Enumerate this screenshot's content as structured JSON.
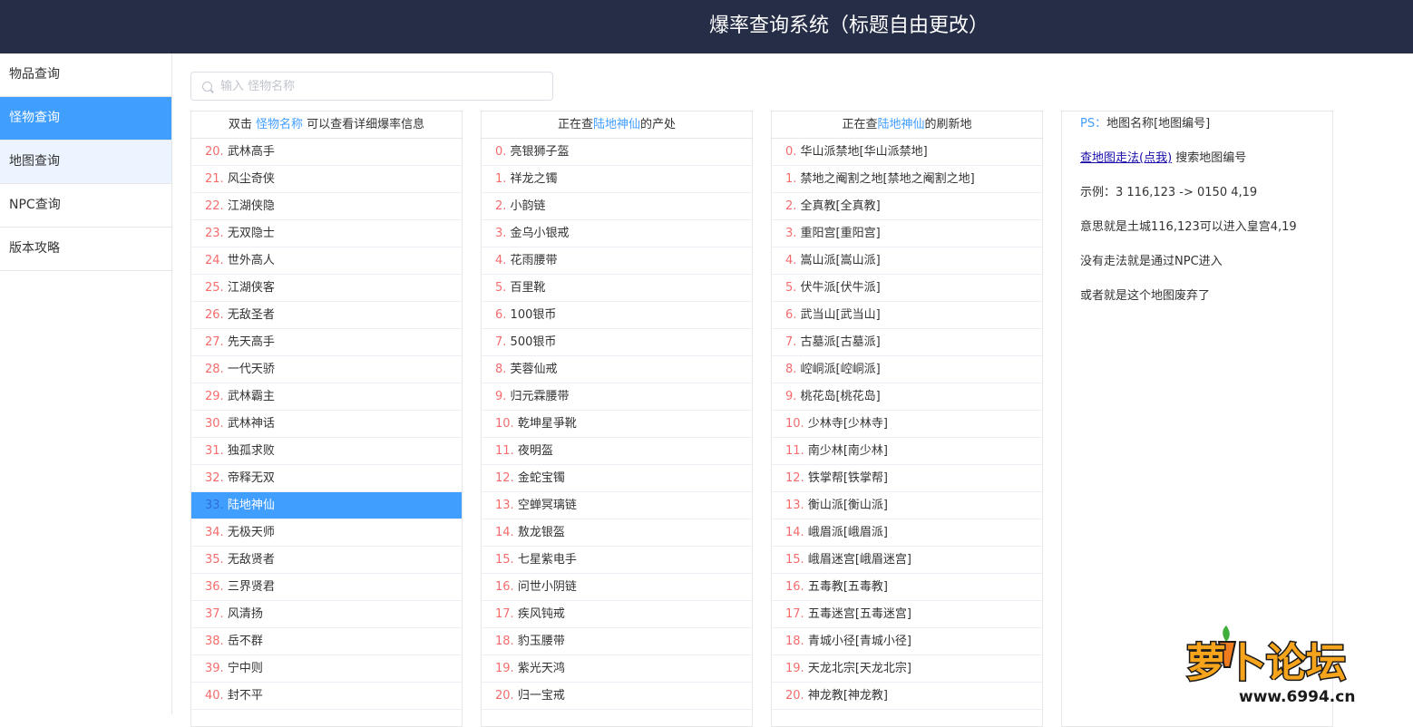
{
  "header": {
    "title": "爆率查询系统（标题自由更改）"
  },
  "sidebar": {
    "items": [
      {
        "label": "物品查询"
      },
      {
        "label": "怪物查询"
      },
      {
        "label": "地图查询"
      },
      {
        "label": "NPC查询"
      },
      {
        "label": "版本攻略"
      }
    ],
    "active_index": 1
  },
  "search": {
    "placeholder": "输入 怪物名称",
    "value": ""
  },
  "monsters": {
    "header_prefix": "双击",
    "header_link": "怪物名称",
    "header_suffix": "可以查看详细爆率信息",
    "selected_index": "33",
    "items": [
      {
        "idx": "20.",
        "name": "武林高手"
      },
      {
        "idx": "21.",
        "name": "风尘奇侠"
      },
      {
        "idx": "22.",
        "name": "江湖侠隐"
      },
      {
        "idx": "23.",
        "name": "无双隐士"
      },
      {
        "idx": "24.",
        "name": "世外高人"
      },
      {
        "idx": "25.",
        "name": "江湖侠客"
      },
      {
        "idx": "26.",
        "name": "无敌圣者"
      },
      {
        "idx": "27.",
        "name": "先天高手"
      },
      {
        "idx": "28.",
        "name": "一代天骄"
      },
      {
        "idx": "29.",
        "name": "武林霸主"
      },
      {
        "idx": "30.",
        "name": "武林神话"
      },
      {
        "idx": "31.",
        "name": "独孤求败"
      },
      {
        "idx": "32.",
        "name": "帝释无双"
      },
      {
        "idx": "33.",
        "name": "陆地神仙"
      },
      {
        "idx": "34.",
        "name": "无极天师"
      },
      {
        "idx": "35.",
        "name": "无敌贤者"
      },
      {
        "idx": "36.",
        "name": "三界贤君"
      },
      {
        "idx": "37.",
        "name": "风清扬"
      },
      {
        "idx": "38.",
        "name": "岳不群"
      },
      {
        "idx": "39.",
        "name": "宁中则"
      },
      {
        "idx": "40.",
        "name": "封不平"
      }
    ]
  },
  "drops": {
    "header_prefix": "正在查",
    "header_monster": "陆地神仙",
    "header_suffix": "的产处",
    "items": [
      {
        "idx": "0.",
        "name": "亮银狮子盔"
      },
      {
        "idx": "1.",
        "name": "祥龙之镯"
      },
      {
        "idx": "2.",
        "name": "小韵链"
      },
      {
        "idx": "3.",
        "name": "金乌小银戒"
      },
      {
        "idx": "4.",
        "name": "花雨腰带"
      },
      {
        "idx": "5.",
        "name": "百里靴"
      },
      {
        "idx": "6.",
        "name": "100银币"
      },
      {
        "idx": "7.",
        "name": "500银币"
      },
      {
        "idx": "8.",
        "name": "芙蓉仙戒"
      },
      {
        "idx": "9.",
        "name": "归元霖腰带"
      },
      {
        "idx": "10.",
        "name": "乾坤星爭靴"
      },
      {
        "idx": "11.",
        "name": "夜明盔"
      },
      {
        "idx": "12.",
        "name": "金蛇宝镯"
      },
      {
        "idx": "13.",
        "name": "空蝉冥璃链"
      },
      {
        "idx": "14.",
        "name": "敖龙银盔"
      },
      {
        "idx": "15.",
        "name": "七星紫电手"
      },
      {
        "idx": "16.",
        "name": "问世小阴链"
      },
      {
        "idx": "17.",
        "name": "疾风钝戒"
      },
      {
        "idx": "18.",
        "name": "豹玉腰带"
      },
      {
        "idx": "19.",
        "name": "紫光天鸿"
      },
      {
        "idx": "20.",
        "name": "归一宝戒"
      }
    ]
  },
  "spawns": {
    "header_prefix": "正在查",
    "header_monster": "陆地神仙",
    "header_suffix": "的刷新地",
    "items": [
      {
        "idx": "0.",
        "name": "华山派禁地[华山派禁地]"
      },
      {
        "idx": "1.",
        "name": "禁地之阉割之地[禁地之阉割之地]"
      },
      {
        "idx": "2.",
        "name": "全真教[全真教]"
      },
      {
        "idx": "3.",
        "name": "重阳宫[重阳宫]"
      },
      {
        "idx": "4.",
        "name": "嵩山派[嵩山派]"
      },
      {
        "idx": "5.",
        "name": "伏牛派[伏牛派]"
      },
      {
        "idx": "6.",
        "name": "武当山[武当山]"
      },
      {
        "idx": "7.",
        "name": "古墓派[古墓派]"
      },
      {
        "idx": "8.",
        "name": "崆峒派[崆峒派]"
      },
      {
        "idx": "9.",
        "name": "桃花岛[桃花岛]"
      },
      {
        "idx": "10.",
        "name": "少林寺[少林寺]"
      },
      {
        "idx": "11.",
        "name": "南少林[南少林]"
      },
      {
        "idx": "12.",
        "name": "铁掌帮[铁掌帮]"
      },
      {
        "idx": "13.",
        "name": "衡山派[衡山派]"
      },
      {
        "idx": "14.",
        "name": "峨眉派[峨眉派]"
      },
      {
        "idx": "15.",
        "name": "峨眉迷宫[峨眉迷宫]"
      },
      {
        "idx": "16.",
        "name": "五毒教[五毒教]"
      },
      {
        "idx": "17.",
        "name": "五毒迷宫[五毒迷宫]"
      },
      {
        "idx": "18.",
        "name": "青城小径[青城小径]"
      },
      {
        "idx": "19.",
        "name": "天龙北宗[天龙北宗]"
      },
      {
        "idx": "20.",
        "name": "神龙教[神龙教]"
      }
    ]
  },
  "info": {
    "ps_label": "PS：",
    "ps_text": "地图名称[地图编号]",
    "link_text": "查地图走法(点我)",
    "link_suffix": "搜索地图编号",
    "example": "示例：3 116,123 -> 0150 4,19",
    "meaning": "意思就是土城116,123可以进入皇宫4,19",
    "no_route": "没有走法就是通过NPC进入",
    "abandoned": "或者就是这个地图废弃了"
  },
  "watermark": {
    "text": "萝卜论坛",
    "url": "www.6994.cn"
  },
  "colors": {
    "header_bg": "#252d47",
    "accent": "#409eff",
    "index": "#f56c6c"
  }
}
